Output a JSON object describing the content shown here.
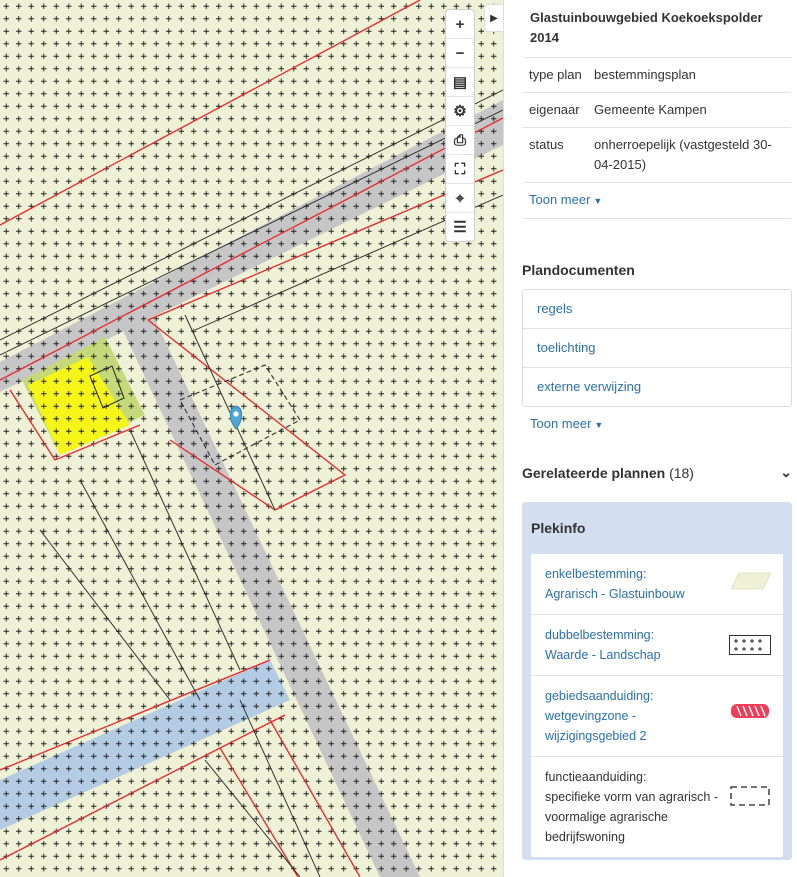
{
  "panel": {
    "plan_title": "Glastuinbouwgebied Koekoekspolder 2014",
    "info": [
      {
        "key": "type plan",
        "value": "bestemmingsplan"
      },
      {
        "key": "eigenaar",
        "value": "Gemeente Kampen"
      },
      {
        "key": "status",
        "value": "onherroepelijk (vastgesteld 30-04-2015)"
      }
    ],
    "show_more": "Toon meer",
    "docs_title": "Plandocumenten",
    "docs": [
      "regels",
      "toelichting",
      "externe verwijzing"
    ],
    "docs_show_more": "Toon meer",
    "related_title": "Gerelateerde plannen",
    "related_count": "(18)",
    "plekinfo_title": "Plekinfo",
    "plekinfo_items": [
      {
        "line1": "enkelbestemming:",
        "line2": "Agrarisch - Glastuinbouw",
        "line3": "",
        "line4": "",
        "legend": "parallelogram-swatch"
      },
      {
        "line1": "dubbelbestemming:",
        "line2": "Waarde - Landschap",
        "line3": "",
        "line4": "",
        "legend": "plus-grid-swatch"
      },
      {
        "line1": "gebiedsaanduiding:",
        "line2": "wetgevingzone -",
        "line3": "wijzigingsgebied 2",
        "line4": "",
        "legend": "red-hatched-swatch"
      },
      {
        "line1": "functieaanduiding:",
        "line2": "specifieke vorm van agrarisch -",
        "line3": "voormalige agrarische",
        "line4": "bedrijfswoning",
        "legend": "dashed-rect-swatch"
      }
    ]
  },
  "map_controls": [
    {
      "name": "zoom-in",
      "glyph": "+"
    },
    {
      "name": "zoom-out",
      "glyph": "−"
    },
    {
      "name": "layers",
      "glyph": "▤"
    },
    {
      "name": "settings",
      "glyph": "⚙"
    },
    {
      "name": "print",
      "glyph": "⎙"
    },
    {
      "name": "fullscreen",
      "glyph": "⛶"
    },
    {
      "name": "locate",
      "glyph": "⌖"
    },
    {
      "name": "legend",
      "glyph": "☰"
    }
  ],
  "colors": {
    "agrarisch": "#eef1d5",
    "plan_border": "#e8242b",
    "road": "#c6c6c6",
    "water": "#b3cbe3",
    "wonen_yellow": "#f5f518",
    "wonen_green": "#c6d97a",
    "link": "#2a6fb0",
    "marker": "#4fa7d8",
    "plekinfo_bg": "#d3dff0"
  }
}
